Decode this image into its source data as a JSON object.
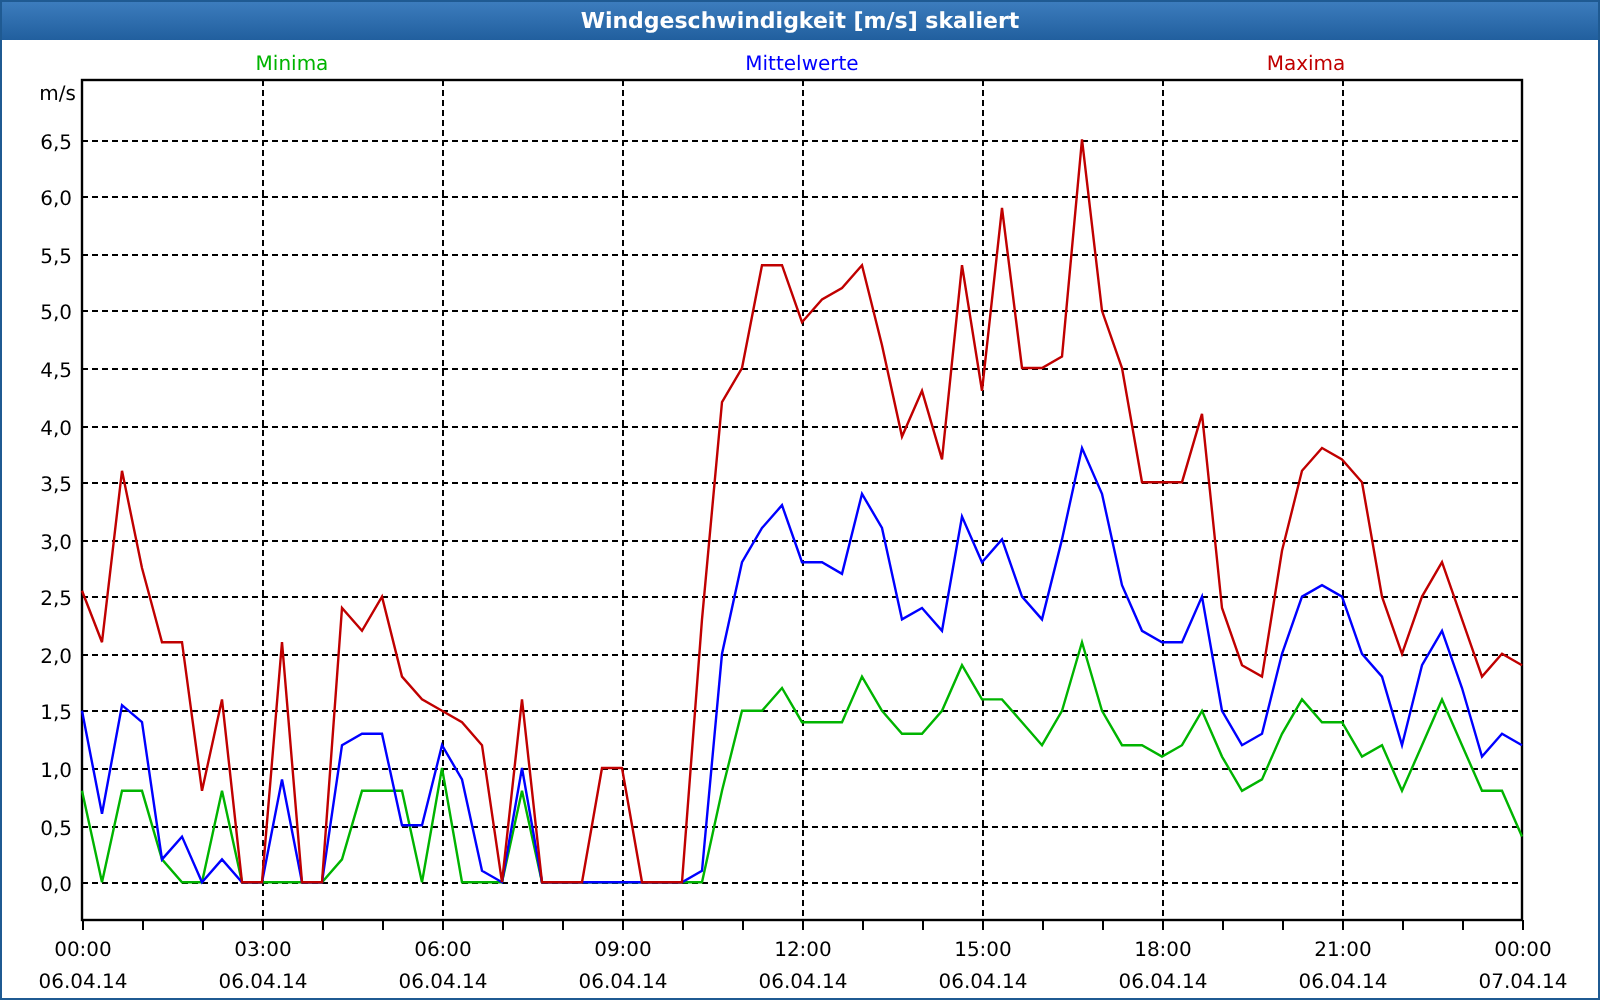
{
  "window": {
    "title": "Windgeschwindigkeit [m/s] skaliert"
  },
  "chart": {
    "chart_data": {
      "type": "line",
      "ylabel": "m/s",
      "categories": [
        "00:00\n06.04.14",
        null,
        null,
        null,
        null,
        null,
        null,
        null,
        null,
        "03:00\n06.04.14",
        null,
        null,
        null,
        null,
        null,
        null,
        null,
        null,
        "06:00\n06.04.14",
        null,
        null,
        null,
        null,
        null,
        null,
        null,
        null,
        "09:00\n06.04.14",
        null,
        null,
        null,
        null,
        null,
        null,
        null,
        null,
        "12:00\n06.04.14",
        null,
        null,
        null,
        null,
        null,
        null,
        null,
        null,
        "15:00\n06.04.14",
        null,
        null,
        null,
        null,
        null,
        null,
        null,
        null,
        "18:00\n06.04.14",
        null,
        null,
        null,
        null,
        null,
        null,
        null,
        null,
        "21:00\n06.04.14",
        null,
        null,
        null,
        null,
        null,
        null,
        null,
        null,
        "00:00\n07.04.14"
      ],
      "series": [
        {
          "name": "Minima",
          "color": "#00b400",
          "values": [
            0.8,
            0,
            0.8,
            0.8,
            0.2,
            0,
            0,
            0.8,
            0,
            0,
            0,
            0,
            0,
            0.2,
            0.8,
            0.8,
            0.8,
            0,
            1.0,
            0,
            0,
            0,
            0.8,
            0,
            0,
            0,
            0,
            0,
            0,
            0,
            0,
            0,
            0.8,
            1.5,
            1.5,
            1.7,
            1.4,
            1.4,
            1.4,
            1.8,
            1.5,
            1.3,
            1.3,
            1.5,
            1.9,
            1.6,
            1.6,
            1.4,
            1.2,
            1.5,
            2.1,
            1.5,
            1.2,
            1.2,
            1.1,
            1.2,
            1.5,
            1.1,
            0.8,
            0.9,
            1.3,
            1.6,
            1.4,
            1.4,
            1.1,
            1.2,
            0.8,
            1.2,
            1.6,
            1.2,
            0.8,
            0.8,
            0.4
          ]
        },
        {
          "name": "Mittelwerte",
          "color": "#0000ff",
          "values": [
            1.5,
            0.6,
            1.55,
            1.4,
            0.2,
            0.4,
            0,
            0.2,
            0,
            0,
            0.9,
            0,
            0,
            1.2,
            1.3,
            1.3,
            0.5,
            0.5,
            1.2,
            0.9,
            0.1,
            0,
            1.0,
            0,
            0,
            0,
            0,
            0,
            0,
            0,
            0,
            0.1,
            2.0,
            2.8,
            3.1,
            3.3,
            2.8,
            2.8,
            2.7,
            3.4,
            3.1,
            2.3,
            2.4,
            2.2,
            3.2,
            2.8,
            3.0,
            2.5,
            2.3,
            3.0,
            3.8,
            3.4,
            2.6,
            2.2,
            2.1,
            2.1,
            2.5,
            1.5,
            1.2,
            1.3,
            2.0,
            2.5,
            2.6,
            2.5,
            2.0,
            1.8,
            1.2,
            1.9,
            2.2,
            1.7,
            1.1,
            1.3,
            1.2
          ]
        },
        {
          "name": "Maxima",
          "color": "#c00000",
          "values": [
            2.55,
            2.1,
            3.6,
            2.75,
            2.1,
            2.1,
            0.8,
            1.6,
            0,
            0,
            2.1,
            0,
            0,
            2.4,
            2.2,
            2.5,
            1.8,
            1.6,
            1.5,
            1.4,
            1.2,
            0,
            1.6,
            0,
            0,
            0,
            1.0,
            1.0,
            0,
            0,
            0,
            2.3,
            4.2,
            4.5,
            5.4,
            5.4,
            4.9,
            5.1,
            5.2,
            5.4,
            4.7,
            3.9,
            4.3,
            3.7,
            5.4,
            4.3,
            5.9,
            4.5,
            4.5,
            4.6,
            6.5,
            5.0,
            4.5,
            3.5,
            3.5,
            3.5,
            4.1,
            2.4,
            1.9,
            1.8,
            2.9,
            3.6,
            3.8,
            3.7,
            3.5,
            2.5,
            2.0,
            2.5,
            2.8,
            2.3,
            1.8,
            2.0,
            1.9
          ]
        }
      ],
      "ylim": [
        -0.33,
        7.02
      ],
      "grid": true,
      "yticks": [
        {
          "value": 0,
          "label": "0,0"
        },
        {
          "value": 0.5,
          "label": "0,5"
        },
        {
          "value": 1,
          "label": "1,0"
        },
        {
          "value": 1.5,
          "label": "1,5"
        },
        {
          "value": 2,
          "label": "2,0"
        },
        {
          "value": 2.5,
          "label": "2,5"
        },
        {
          "value": 3,
          "label": "3,0"
        },
        {
          "value": 3.5,
          "label": "3,5"
        },
        {
          "value": 4,
          "label": "4,0"
        },
        {
          "value": 4.5,
          "label": "4,5"
        },
        {
          "value": 5,
          "label": "5,0"
        },
        {
          "value": 5.5,
          "label": "5,5"
        },
        {
          "value": 6,
          "label": "6,0"
        },
        {
          "value": 6.5,
          "label": "6,5"
        }
      ]
    }
  }
}
